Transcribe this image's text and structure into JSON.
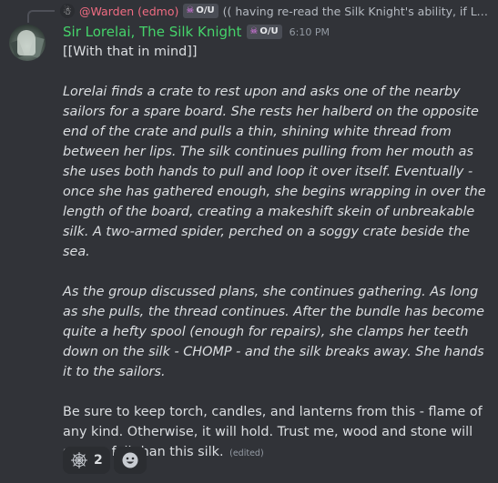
{
  "reply": {
    "author": "@Warden (edmo)",
    "badge": "O/U",
    "text": "(( having re-read the Silk Knight's ability, if Lor..."
  },
  "author": {
    "name": "Sir Lorelai, The Silk Knight",
    "badge": "O/U",
    "timestamp": "6:10 PM"
  },
  "message": {
    "line1": "[[With that in mind]]",
    "para1": "Lorelai finds a crate to rest upon and asks one of the nearby sailors for a spare board. She rests her halberd on the opposite end of the crate and pulls a thin, shining white thread from between her lips. The silk continues pulling from her mouth as she uses both hands to pull and loop it over itself. Eventually - once she has gathered enough, she begins wrapping in over the length of the board, creating a makeshift skein of unbreakable silk. A two-armed spider, perched on a soggy crate beside the sea.",
    "para2": "As the group discussed plans, she continues gathering. As long as she pulls, the thread continues. After the bundle has become quite a hefty spool (enough for repairs), she clamps her teeth down on the silk - CHOMP - and the silk breaks away. She hands it to the sailors.",
    "para3": "Be sure to keep torch, candles, and lanterns from this - flame of any kind. Otherwise, it will hold. Trust me, wood and stone will sooner fail than this silk.",
    "edited": "(edited)"
  },
  "reactions": [
    {
      "icon": "spider-web-icon",
      "count": "2"
    }
  ],
  "colors": {
    "background": "#313338",
    "username": "#45d36a",
    "reply_name": "#f06c82"
  }
}
